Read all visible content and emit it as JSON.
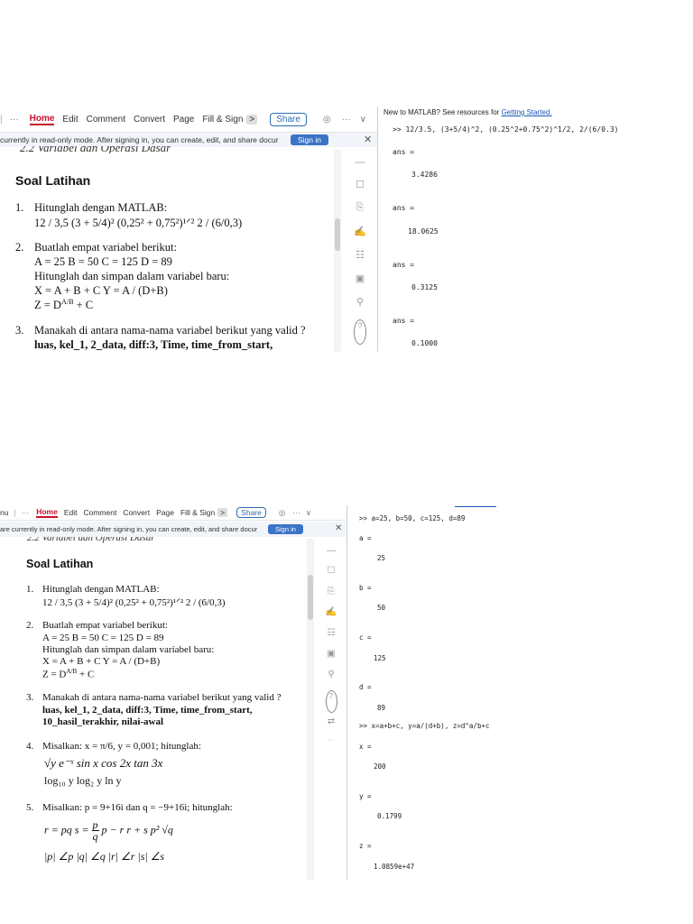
{
  "toolbar": {
    "menu_cut": "nu",
    "dots": "···",
    "items": [
      "Home",
      "Edit",
      "Comment",
      "Convert",
      "Page",
      "Fill & Sign"
    ],
    "arrow": ">",
    "share": "Share",
    "more": "···",
    "chevron": "∨"
  },
  "notice": {
    "text_top": "currently in read-only mode. After signing in, you can create, edit, and share docur",
    "text_bottom": "are currently in read-only mode. After signing in, you can create, edit, and share docur",
    "signin": "Sign in",
    "close": "✕"
  },
  "document": {
    "cut_header": "2.2  Variabel dan Operasi Dasar",
    "title": "Soal Latihan",
    "q1_label": "1.",
    "q1_text": "Hitunglah dengan MATLAB:",
    "q1_expr": "12 / 3,5    (3 + 5/4)²    (0,25² + 0,75²)¹ᐟ²    2 / (6/0,3)",
    "q2_label": "2.",
    "q2_text": "Buatlah empat variabel berikut:",
    "q2_vars": "A = 25    B = 50    C = 125    D = 89",
    "q2_text2": "Hitunglah dan simpan dalam variabel baru:",
    "q2_expr1": "X = A + B + C          Y = A / (D+B)",
    "q2_expr2_a": "Z = D",
    "q2_expr2_sup": "A/B",
    "q2_expr2_b": " + C",
    "q3_label": "3.",
    "q3_text": "Manakah di antara nama-nama variabel berikut yang valid ?",
    "q3_list1": "luas, kel_1, 2_data, diff:3, Time, time_from_start,",
    "q3_list2": "10_hasil_terakhir, nilai-awal",
    "q4_label": "4.",
    "q4_text": "Misalkan: x = π/6, y = 0,001; hitunglah:",
    "q4_row1": "√y    e⁻ˣ    sin x    cos 2x    tan 3x",
    "q4_row2": "log₁₀ y    log₂ y    ln y",
    "q5_label": "5.",
    "q5_text": "Misalkan: p = 9+16i  dan  q = −9+16i; hitunglah:",
    "q5_row1a": "r = pq     s =",
    "q5_frac_top": "p",
    "q5_frac_bot": "q",
    "q5_row1b": "     p − r     r + s     p²     √q",
    "q5_row2": "|p|   ∠p   |q|   ∠q   |r|   ∠r   |s|   ∠s"
  },
  "sidebar_icons": [
    "minus-icon",
    "edit-icon",
    "export-icon",
    "sign-icon",
    "organize-icon",
    "compress-icon",
    "search-icon",
    "help-icon",
    "compare-icon",
    "more-icon"
  ],
  "sidebar_glyphs": [
    "—",
    "☐",
    "⎘",
    "✍",
    "☷",
    "▣",
    "⚲",
    "?",
    "⇄",
    "···"
  ],
  "matlab_top": {
    "help_text": "New to MATLAB? See resources for ",
    "help_link": "Getting Started.",
    "cmd": ">> 12/3.5, (3+5/4)^2, (0.25^2+0.75^2)^1/2, 2/(6/0.3)",
    "outputs": [
      {
        "label": "ans =",
        "value": "3.4286"
      },
      {
        "label": "ans =",
        "value": "18.0625"
      },
      {
        "label": "ans =",
        "value": "0.3125"
      },
      {
        "label": "ans =",
        "value": "0.1000"
      }
    ]
  },
  "matlab_bottom": {
    "cmd1": ">> a=25, b=50, c=125, d=89",
    "vars": [
      {
        "label": "a =",
        "value": "25"
      },
      {
        "label": "b =",
        "value": "50"
      },
      {
        "label": "c =",
        "value": "125"
      },
      {
        "label": "d =",
        "value": "89"
      }
    ],
    "cmd2": ">> x=a+b+c, y=a/(d+b), z=d^a/b+c",
    "results": [
      {
        "label": "x =",
        "value": "200"
      },
      {
        "label": "y =",
        "value": "0.1799"
      },
      {
        "label": "z =",
        "value": "1.0859e+47"
      }
    ]
  }
}
